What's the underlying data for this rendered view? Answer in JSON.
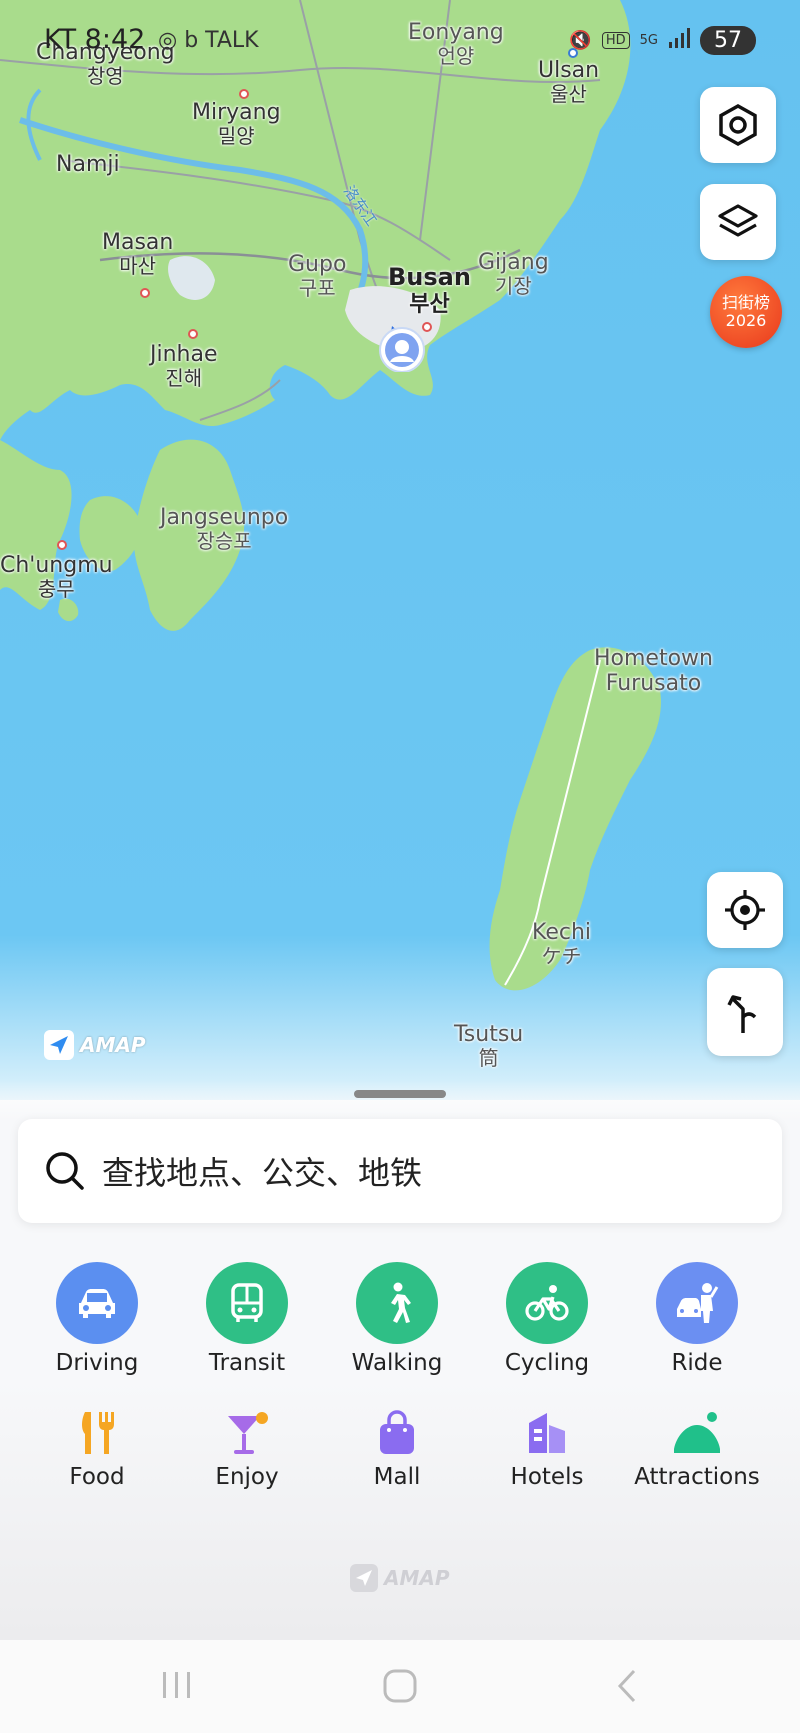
{
  "status_bar": {
    "time": "KT 8:42",
    "left_icons": "◎ b TALK",
    "hd": "HD",
    "network": "5G",
    "battery": "57"
  },
  "map": {
    "labels": [
      {
        "en": "Changyeong",
        "ko": "창영"
      },
      {
        "en": "Eonyang",
        "ko": "언양"
      },
      {
        "en": "Ulsan",
        "ko": "울산"
      },
      {
        "en": "Miryang",
        "ko": "밀양"
      },
      {
        "en": "Namji",
        "ko": ""
      },
      {
        "en": "Masan",
        "ko": "마산"
      },
      {
        "en": "Gupo",
        "ko": "구포"
      },
      {
        "en": "Busan",
        "ko": "부산"
      },
      {
        "en": "Gijang",
        "ko": "기장"
      },
      {
        "en": "Jinhae",
        "ko": "진해"
      },
      {
        "en": "Jangseunpo",
        "ko": "장승포"
      },
      {
        "en": "Ch'ungmu",
        "ko": "충무"
      },
      {
        "en": "Hometown",
        "ko": "Furusato"
      },
      {
        "en": "Kechi",
        "ko": "ケチ"
      },
      {
        "en": "Tsutsu",
        "ko": "筒"
      }
    ],
    "river_label": "洛东江",
    "promo_badge": {
      "line1": "扫街榜",
      "line2": "2026"
    },
    "watermark": "AMAP"
  },
  "search": {
    "placeholder": "查找地点、公交、地铁"
  },
  "transport": [
    {
      "label": "Driving",
      "icon": "car-icon",
      "color": "#5b8ff0"
    },
    {
      "label": "Transit",
      "icon": "bus-icon",
      "color": "#2fbf86"
    },
    {
      "label": "Walking",
      "icon": "walking-icon",
      "color": "#2fbf86"
    },
    {
      "label": "Cycling",
      "icon": "cycling-icon",
      "color": "#2fbf86"
    },
    {
      "label": "Ride",
      "icon": "ride-icon",
      "color": "#6b8ff2"
    }
  ],
  "categories": [
    {
      "label": "Food",
      "icon": "food-icon",
      "color": "#f5a623"
    },
    {
      "label": "Enjoy",
      "icon": "cocktail-icon",
      "color": "#a66be8"
    },
    {
      "label": "Mall",
      "icon": "shopping-bag-icon",
      "color": "#8a6cf0"
    },
    {
      "label": "Hotels",
      "icon": "hotel-icon",
      "color": "#8a6cf0"
    },
    {
      "label": "Attractions",
      "icon": "attractions-icon",
      "color": "#20c08a"
    }
  ],
  "footer": {
    "brand": "AMAP"
  }
}
